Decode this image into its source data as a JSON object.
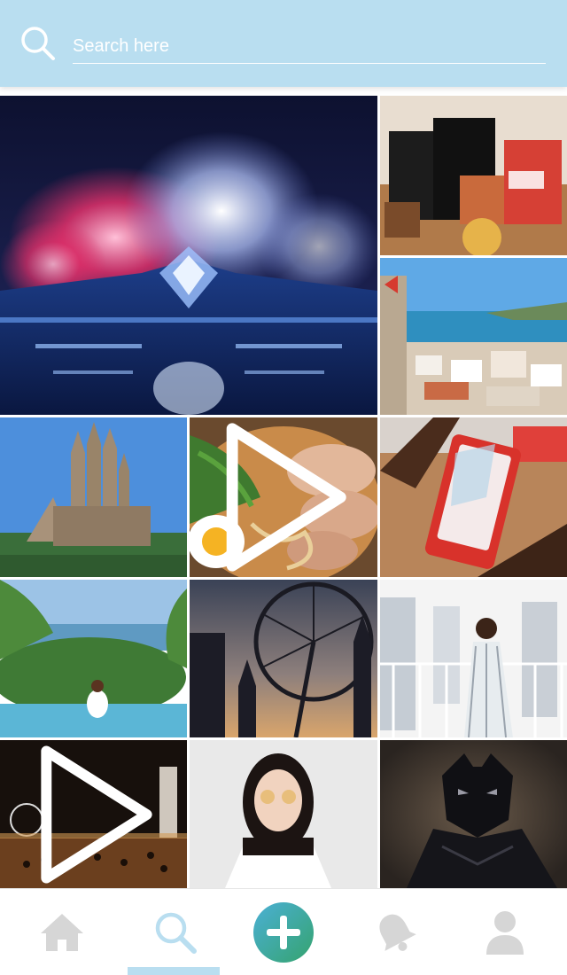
{
  "search": {
    "placeholder": "Search here"
  },
  "grid": {
    "tiles": [
      {
        "subject": "fireworks-stage",
        "video": false
      },
      {
        "subject": "shopping-bags",
        "video": false
      },
      {
        "subject": "coastal-town",
        "video": false
      },
      {
        "subject": "cathedral",
        "video": false
      },
      {
        "subject": "ramen-bowl",
        "video": true
      },
      {
        "subject": "phone-screen-protector",
        "video": false
      },
      {
        "subject": "beach-pool",
        "video": false
      },
      {
        "subject": "ferris-wheel-sunset",
        "video": false
      },
      {
        "subject": "woman-on-balcony",
        "video": false
      },
      {
        "subject": "night-marathon",
        "video": true
      },
      {
        "subject": "woman-portrait",
        "video": false
      },
      {
        "subject": "black-panther",
        "video": false
      }
    ]
  },
  "nav": {
    "items": [
      {
        "icon": "home-icon",
        "active": false
      },
      {
        "icon": "search-icon",
        "active": true
      },
      {
        "icon": "plus-icon",
        "active": false
      },
      {
        "icon": "bell-icon",
        "active": false
      },
      {
        "icon": "profile-icon",
        "active": false
      }
    ]
  },
  "colors": {
    "header": "#b9def0",
    "nav_inactive": "#d6d6d6",
    "nav_active": "#b9def0",
    "accent_gradient_start": "#4bb0d6",
    "accent_gradient_end": "#35a36e"
  }
}
